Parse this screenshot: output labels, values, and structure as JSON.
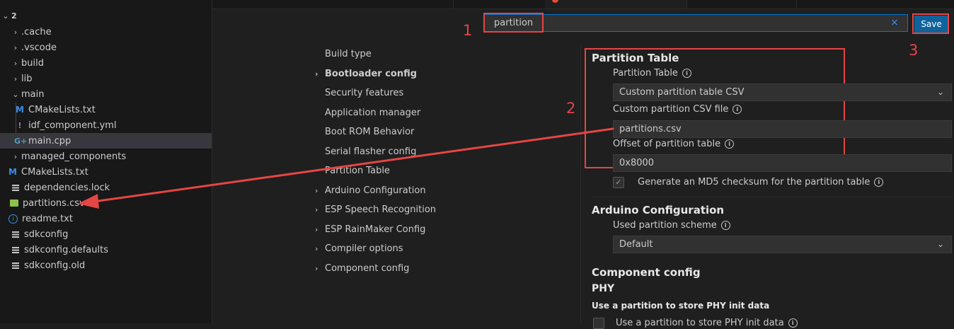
{
  "explorer": {
    "root": "2",
    "items": [
      {
        "label": ".cache",
        "kind": "folder"
      },
      {
        "label": ".vscode",
        "kind": "folder"
      },
      {
        "label": "build",
        "kind": "folder"
      },
      {
        "label": "lib",
        "kind": "folder"
      },
      {
        "label": "main",
        "kind": "folder-open"
      },
      {
        "label": "CMakeLists.txt",
        "icon": "cmake-icon"
      },
      {
        "label": "idf_component.yml",
        "icon": "yaml-icon"
      },
      {
        "label": "main.cpp",
        "icon": "cpp-icon",
        "selected": true
      },
      {
        "label": "managed_components",
        "kind": "folder"
      },
      {
        "label": "CMakeLists.txt",
        "icon": "cmake-icon"
      },
      {
        "label": "dependencies.lock",
        "icon": "text-lines-icon"
      },
      {
        "label": "partitions.csv",
        "icon": "csv-table-icon"
      },
      {
        "label": "readme.txt",
        "icon": "info-icon"
      },
      {
        "label": "sdkconfig",
        "icon": "text-lines-icon"
      },
      {
        "label": "sdkconfig.defaults",
        "icon": "text-lines-icon"
      },
      {
        "label": "sdkconfig.old",
        "icon": "text-lines-icon"
      }
    ]
  },
  "search": {
    "value": "partition",
    "clear_glyph": "×"
  },
  "toolbar": {
    "save_label": "Save"
  },
  "annotations": {
    "one": "1",
    "two": "2",
    "three": "3"
  },
  "categories": [
    {
      "label": "Build type",
      "expandable": false,
      "bold": false
    },
    {
      "label": "Bootloader config",
      "expandable": true,
      "bold": true
    },
    {
      "label": "Security features",
      "expandable": false,
      "bold": false
    },
    {
      "label": "Application manager",
      "expandable": false,
      "bold": false
    },
    {
      "label": "Boot ROM Behavior",
      "expandable": false,
      "bold": false
    },
    {
      "label": "Serial flasher config",
      "expandable": false,
      "bold": false
    },
    {
      "label": "Partition Table",
      "expandable": false,
      "bold": false
    },
    {
      "label": "Arduino Configuration",
      "expandable": true,
      "bold": false
    },
    {
      "label": "ESP Speech Recognition",
      "expandable": true,
      "bold": false
    },
    {
      "label": "ESP RainMaker Config",
      "expandable": true,
      "bold": false
    },
    {
      "label": "Compiler options",
      "expandable": true,
      "bold": false
    },
    {
      "label": "Component config",
      "expandable": true,
      "bold": false
    }
  ],
  "settings": {
    "partition_table": {
      "heading": "Partition Table",
      "table_label": "Partition Table",
      "table_value": "Custom partition table CSV",
      "csv_label": "Custom partition CSV file",
      "csv_value": "partitions.csv",
      "offset_label": "Offset of partition table",
      "offset_value": "0x8000",
      "md5_label": "Generate an MD5 checksum for the partition table",
      "md5_checked": true
    },
    "arduino": {
      "heading": "Arduino Configuration",
      "scheme_label": "Used partition scheme",
      "scheme_value": "Default"
    },
    "component": {
      "heading": "Component config",
      "sub_heading": "PHY",
      "phy_heading": "Use a partition to store PHY init data",
      "phy_option_label": "Use a partition to store PHY init data"
    }
  },
  "colors": {
    "annotation": "#e64545",
    "accent": "#0078d4",
    "save_button": "#0e639c"
  }
}
